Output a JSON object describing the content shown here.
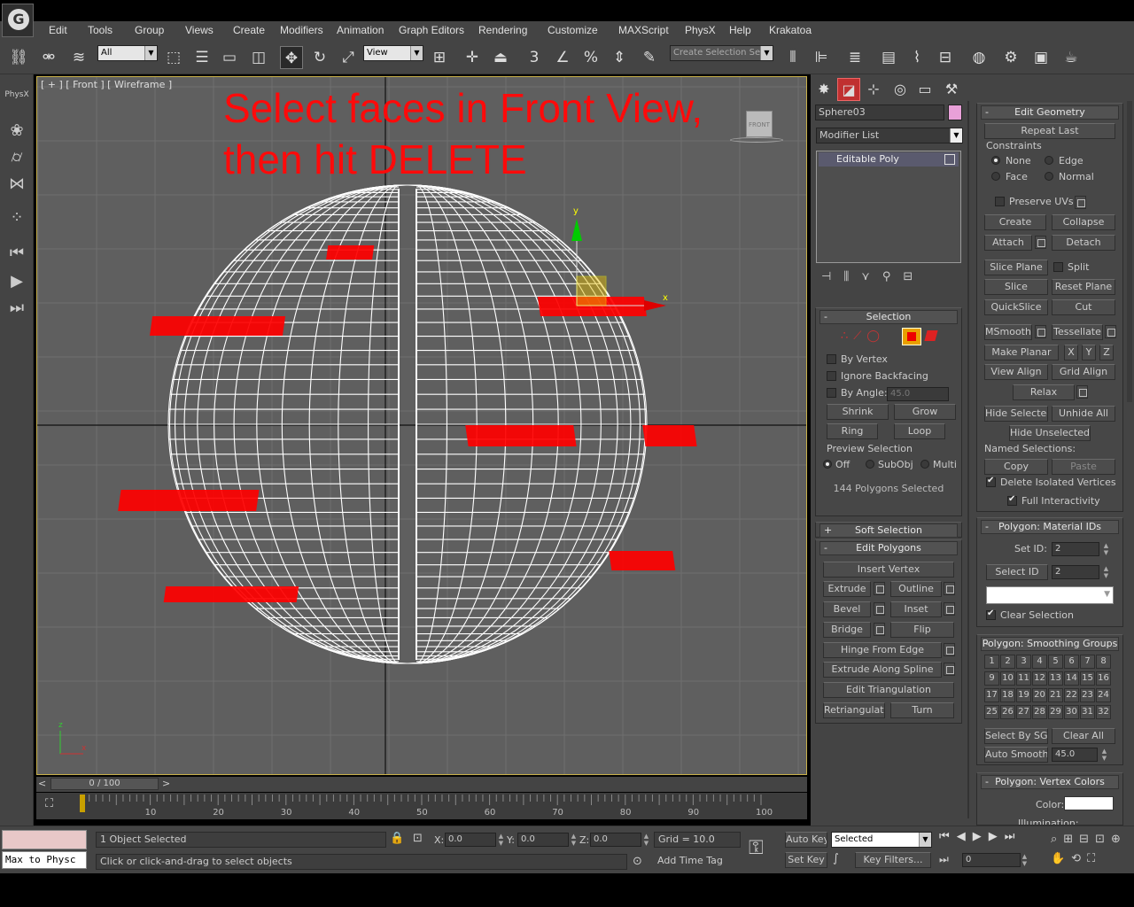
{
  "app": {
    "logo_letter": "G"
  },
  "menu": [
    "Edit",
    "Tools",
    "Group",
    "Views",
    "Create",
    "Modifiers",
    "Animation",
    "Graph Editors",
    "Rendering",
    "Customize",
    "MAXScript",
    "PhysX",
    "Help",
    "Krakatoa"
  ],
  "toolbar": {
    "filter_value": "All",
    "refcoord_value": "View",
    "named_selection_value": "Create Selection Se",
    "snap_label": "3",
    "angle_snap_label": "n",
    "percent_label": "%",
    "icons": [
      "link-icon",
      "unlink-icon",
      "bind-space-warp-icon",
      "select-object-icon",
      "select-by-name-icon",
      "rect-region-icon",
      "window-crossing-icon",
      "move-icon",
      "rotate-icon",
      "scale-icon",
      "pivot-icon",
      "manipulate-icon",
      "keyboard-shortcut-icon",
      "snap-icon",
      "angle-snap-icon",
      "percent-snap-icon",
      "spinner-snap-icon",
      "edit-named-sel-icon",
      "mirror-icon",
      "align-icon",
      "layer-icon",
      "graphite-icon",
      "curve-editor-icon",
      "schematic-icon",
      "material-editor-icon",
      "render-setup-icon",
      "render-frame-icon",
      "render-icon"
    ]
  },
  "left_tools": {
    "physx_label": "PhysX"
  },
  "viewport": {
    "label": "[ + ] [ Front ] [ Wireframe ]",
    "annotation_line1": "Select faces in Front View,",
    "annotation_line2": "then hit DELETE",
    "viewcube_label": "FRONT",
    "gizmo_x": "x",
    "gizmo_y": "y",
    "axis_z": "z",
    "axis_x": "x",
    "colors": {
      "selected_face": "#ff0000",
      "wire": "#ffffff",
      "grid": "#6f6f6f",
      "bg": "#5f5f5f"
    }
  },
  "cmdpanel": {
    "object_name": "Sphere03",
    "object_color": "#e8a0d8",
    "modifier_list": "Modifier List",
    "stack_item": "Editable Poly",
    "selection": {
      "title": "Selection",
      "by_vertex": "By Vertex",
      "ignore_backfacing": "Ignore Backfacing",
      "by_angle": "By Angle:",
      "angle_value": "45.0",
      "shrink": "Shrink",
      "grow": "Grow",
      "ring": "Ring",
      "loop": "Loop",
      "preview_title": "Preview Selection",
      "off": "Off",
      "subobj": "SubObj",
      "multi": "Multi",
      "status": "144 Polygons Selected"
    },
    "soft_selection": {
      "title": "Soft Selection"
    },
    "edit_polygons": {
      "title": "Edit Polygons",
      "insert_vertex": "Insert Vertex",
      "extrude": "Extrude",
      "outline": "Outline",
      "bevel": "Bevel",
      "inset": "Inset",
      "bridge": "Bridge",
      "flip": "Flip",
      "hinge": "Hinge From Edge",
      "extrude_spline": "Extrude Along Spline",
      "edit_tri": "Edit Triangulation",
      "retri": "Retriangulate",
      "turn": "Turn"
    },
    "edit_geometry": {
      "title": "Edit Geometry",
      "repeat_last": "Repeat Last",
      "constraints": "Constraints",
      "none": "None",
      "edge": "Edge",
      "face": "Face",
      "normal": "Normal",
      "preserve_uvs": "Preserve UVs",
      "create": "Create",
      "collapse": "Collapse",
      "attach": "Attach",
      "detach": "Detach",
      "slice_plane": "Slice Plane",
      "split": "Split",
      "slice": "Slice",
      "reset_plane": "Reset Plane",
      "quickslice": "QuickSlice",
      "cut": "Cut",
      "msmooth": "MSmooth",
      "tessellate": "Tessellate",
      "make_planar": "Make Planar",
      "x": "X",
      "y": "Y",
      "z": "Z",
      "view_align": "View Align",
      "grid_align": "Grid Align",
      "relax": "Relax",
      "hide_selected": "Hide Selected",
      "unhide_all": "Unhide All",
      "hide_unselected": "Hide Unselected",
      "named_selections": "Named Selections:",
      "copy": "Copy",
      "paste": "Paste",
      "delete_isolated": "Delete Isolated Vertices",
      "full_interactivity": "Full Interactivity"
    },
    "material_ids": {
      "title": "Polygon: Material IDs",
      "set_id": "Set ID:",
      "set_id_value": "2",
      "select_id": "Select ID",
      "select_id_value": "2",
      "clear_selection": "Clear Selection"
    },
    "smoothing": {
      "title": "Polygon: Smoothing Groups",
      "groups": [
        "1",
        "2",
        "3",
        "4",
        "5",
        "6",
        "7",
        "8",
        "9",
        "10",
        "11",
        "12",
        "13",
        "14",
        "15",
        "16",
        "17",
        "18",
        "19",
        "20",
        "21",
        "22",
        "23",
        "24",
        "25",
        "26",
        "27",
        "28",
        "29",
        "30",
        "31",
        "32"
      ],
      "select_by_sg": "Select By SG",
      "clear_all": "Clear All",
      "auto_smooth": "Auto Smooth",
      "auto_smooth_value": "45.0"
    },
    "vertex_colors": {
      "title": "Polygon: Vertex Colors",
      "color": "Color:",
      "illumination": "Illumination:"
    }
  },
  "timeline": {
    "frame_display": "0 / 100",
    "prev": "<",
    "next": ">",
    "ticks": [
      "10",
      "20",
      "30",
      "40",
      "50",
      "60",
      "70",
      "80",
      "90",
      "100"
    ]
  },
  "status": {
    "maxscript_listener": "Max to Physc",
    "objects_selected": "1 Object Selected",
    "prompt": "Click or click-and-drag to select objects",
    "x_label": "X:",
    "x_value": "0.0",
    "y_label": "Y:",
    "y_value": "0.0",
    "z_label": "Z:",
    "z_value": "0.0",
    "grid": "Grid = 10.0",
    "add_time_tag": "Add Time Tag",
    "auto_key": "Auto Key",
    "set_key": "Set Key",
    "key_mode_value": "Selected",
    "key_filters": "Key Filters...",
    "current_frame": "0"
  }
}
